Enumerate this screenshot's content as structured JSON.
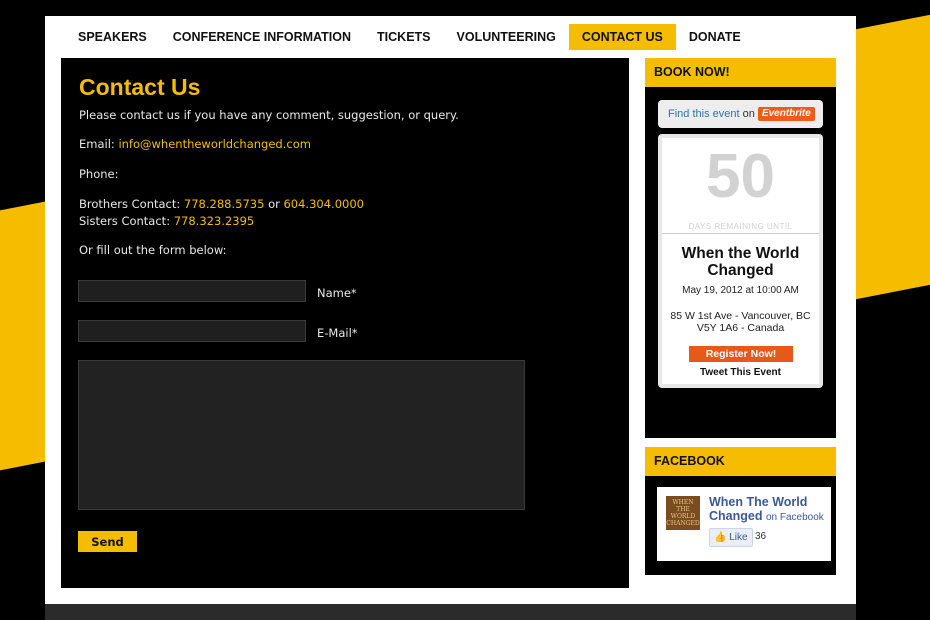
{
  "nav": {
    "items": [
      "SPEAKERS",
      "CONFERENCE INFORMATION",
      "TICKETS",
      "VOLUNTEERING",
      "CONTACT US",
      "DONATE"
    ],
    "active_index": 4
  },
  "main": {
    "title": "Contact Us",
    "intro": "Please contact us if you have any comment, suggestion, or query.",
    "email_label": "Email:",
    "email": "info@whentheworldchanged.com",
    "phone_label": "Phone:",
    "brothers_label": "Brothers Contact:",
    "brothers_phone_1": "778.288.5735",
    "or": "or",
    "brothers_phone_2": "604.304.0000",
    "sisters_label": "Sisters Contact:",
    "sisters_phone": "778.323.2395",
    "form_intro": "Or fill out the form below:",
    "form": {
      "name_label": "Name*",
      "name_value": "",
      "email_label": "E-Mail*",
      "email_value": "",
      "message_value": "",
      "send_label": "Send"
    }
  },
  "sidebar": {
    "book_now": {
      "heading": "BOOK NOW!",
      "find_text": "Find this event",
      "find_on": "on",
      "eventbrite_label": "Eventbrite",
      "days_remaining": "50",
      "days_label": "DAYS REMAINING UNTIL",
      "event_name": "When the World Changed",
      "event_date": "May 19, 2012 at 10:00 AM",
      "address_line1": "85 W 1st Ave - Vancouver, BC",
      "address_line2": "V5Y 1A6 - Canada",
      "register_label": "Register Now!",
      "tweet_label": "Tweet This Event"
    },
    "facebook": {
      "heading": "FACEBOOK",
      "thumb_text": "WHEN THE WORLD CHANGED",
      "page_name": "When The World Changed",
      "on_facebook": "on Facebook",
      "like_label": "Like",
      "like_count": "36"
    }
  },
  "colors": {
    "accent": "#f6bd00",
    "background": "#000000",
    "page": "#ffffff",
    "eventbrite_orange": "#e8581b",
    "facebook_blue": "#3b5998"
  }
}
